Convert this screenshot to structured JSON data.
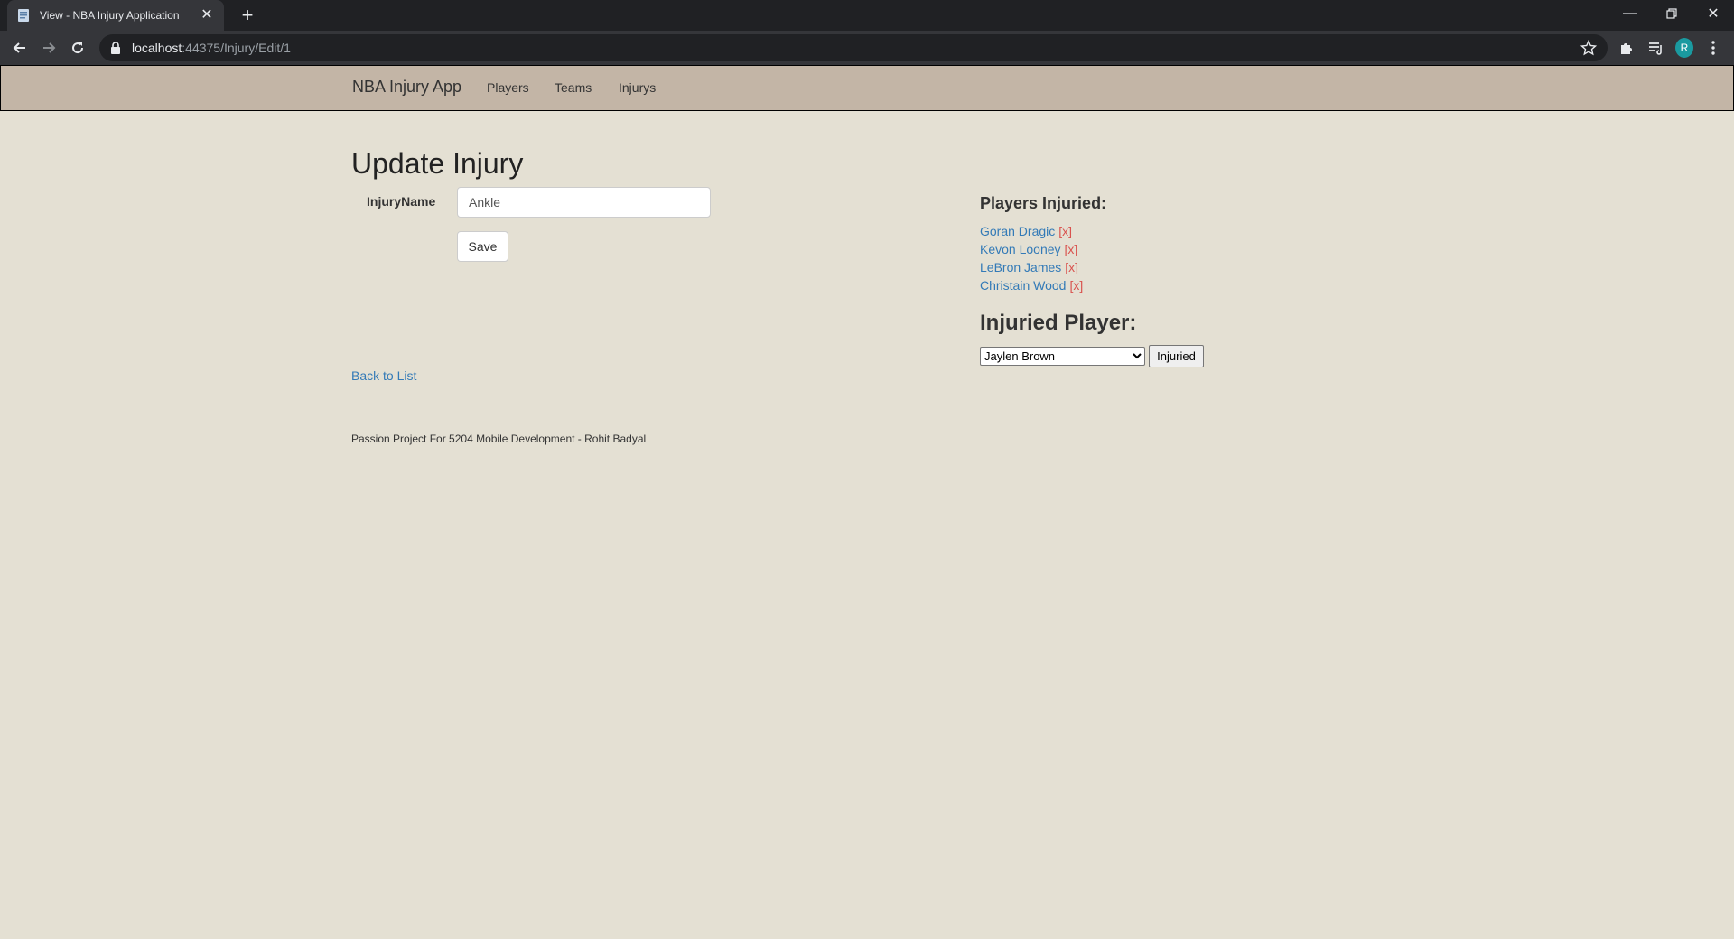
{
  "browser": {
    "tab_title": "View - NBA Injury Application",
    "url_host": "localhost",
    "url_rest": ":44375/Injury/Edit/1",
    "profile_initial": "R"
  },
  "navbar": {
    "brand": "NBA Injury App",
    "links": [
      "Players",
      "Teams",
      "Injurys"
    ]
  },
  "form": {
    "title": "Update Injury",
    "injury_name_label": "InjuryName",
    "injury_name_value": "Ankle",
    "save_label": "Save",
    "back_label": "Back to List"
  },
  "sidebar": {
    "players_heading": "Players Injuried:",
    "injured_players": [
      {
        "name": "Goran Dragic",
        "remove": "[x]"
      },
      {
        "name": "Kevon Looney",
        "remove": "[x]"
      },
      {
        "name": "LeBron James",
        "remove": "[x]"
      },
      {
        "name": "Christain Wood",
        "remove": "[x]"
      }
    ],
    "add_heading": "Injuried Player:",
    "selected_player": "Jaylen Brown",
    "submit_label": "Injuried"
  },
  "footer": {
    "text": "Passion Project For 5204 Mobile Development - Rohit Badyal"
  },
  "colors": {
    "navbar_bg": "#c3b5a6",
    "page_bg": "#e4e0d3",
    "link": "#337ab7",
    "remove": "#d9534f"
  }
}
